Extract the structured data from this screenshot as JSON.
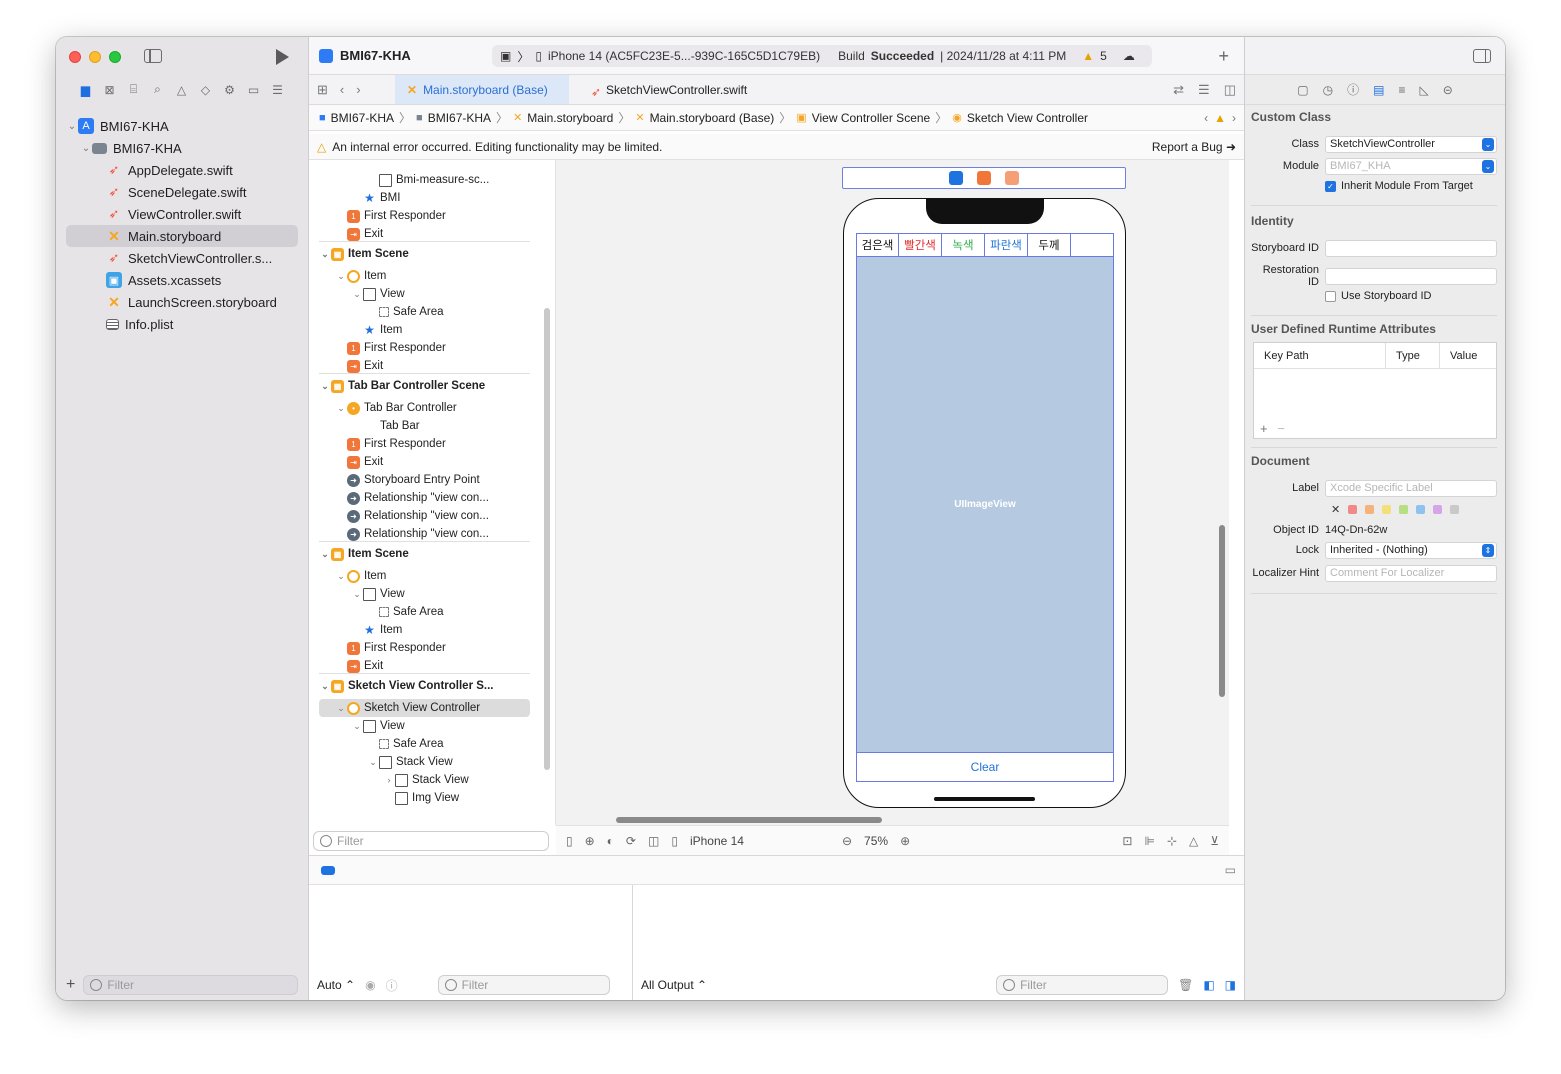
{
  "project": {
    "name": "BMI67-KHA",
    "folder": "BMI67-KHA"
  },
  "navigator": {
    "files": [
      {
        "name": "AppDelegate.swift",
        "type": "swift"
      },
      {
        "name": "SceneDelegate.swift",
        "type": "swift"
      },
      {
        "name": "ViewController.swift",
        "type": "swift"
      },
      {
        "name": "Main.storyboard",
        "type": "storyboard",
        "selected": true
      },
      {
        "name": "SketchViewController.s...",
        "type": "swift"
      },
      {
        "name": "Assets.xcassets",
        "type": "assets"
      },
      {
        "name": "LaunchScreen.storyboard",
        "type": "storyboard"
      },
      {
        "name": "Info.plist",
        "type": "plist"
      }
    ],
    "filter_placeholder": "Filter"
  },
  "toolbar": {
    "device": "iPhone 14 (AC5FC23E-5...-939C-165C5D1C79EB)",
    "build_label": "Build",
    "build_status": "Succeeded",
    "build_time": "| 2024/11/28 at 4:11 PM",
    "warnings": "5"
  },
  "tabs": [
    {
      "label": "Main.storyboard (Base)",
      "active": true
    },
    {
      "label": "SketchViewController.swift",
      "active": false
    }
  ],
  "breadcrumb": [
    "BMI67-KHA",
    "BMI67-KHA",
    "Main.storyboard",
    "Main.storyboard (Base)",
    "View Controller Scene",
    "Sketch View Controller"
  ],
  "error_bar": {
    "message": "An internal error occurred. Editing functionality may be limited.",
    "report": "Report a Bug"
  },
  "outline": {
    "rows": [
      {
        "text": "Bmi-measure-sc...",
        "icon": "img",
        "indent": 4
      },
      {
        "text": "BMI",
        "icon": "star",
        "indent": 3
      },
      {
        "text": "First Responder",
        "icon": "resp",
        "indent": 2
      },
      {
        "text": "Exit",
        "icon": "exit",
        "indent": 2
      },
      {
        "text": "Item Scene",
        "icon": "scene",
        "indent": 1,
        "header": true
      },
      {
        "text": "Item",
        "icon": "item",
        "indent": 2
      },
      {
        "text": "View",
        "icon": "view",
        "indent": 3
      },
      {
        "text": "Safe Area",
        "icon": "safe",
        "indent": 4
      },
      {
        "text": "Item",
        "icon": "star",
        "indent": 3
      },
      {
        "text": "First Responder",
        "icon": "resp",
        "indent": 2
      },
      {
        "text": "Exit",
        "icon": "exit",
        "indent": 2
      },
      {
        "text": "Tab Bar Controller Scene",
        "icon": "scene",
        "indent": 1,
        "header": true
      },
      {
        "text": "Tab Bar Controller",
        "icon": "tabbar",
        "indent": 2
      },
      {
        "text": "Tab Bar",
        "icon": "none",
        "indent": 3
      },
      {
        "text": "First Responder",
        "icon": "resp",
        "indent": 2
      },
      {
        "text": "Exit",
        "icon": "exit",
        "indent": 2
      },
      {
        "text": "Storyboard Entry Point",
        "icon": "entry",
        "indent": 2
      },
      {
        "text": "Relationship \"view con...",
        "icon": "entry",
        "indent": 2
      },
      {
        "text": "Relationship \"view con...",
        "icon": "entry",
        "indent": 2
      },
      {
        "text": "Relationship \"view con...",
        "icon": "entry",
        "indent": 2
      },
      {
        "text": "Item Scene",
        "icon": "scene",
        "indent": 1,
        "header": true
      },
      {
        "text": "Item",
        "icon": "item",
        "indent": 2
      },
      {
        "text": "View",
        "icon": "view",
        "indent": 3
      },
      {
        "text": "Safe Area",
        "icon": "safe",
        "indent": 4
      },
      {
        "text": "Item",
        "icon": "star",
        "indent": 3
      },
      {
        "text": "First Responder",
        "icon": "resp",
        "indent": 2
      },
      {
        "text": "Exit",
        "icon": "exit",
        "indent": 2
      },
      {
        "text": "Sketch View Controller S...",
        "icon": "scene",
        "indent": 1,
        "header": true
      },
      {
        "text": "Sketch View Controller",
        "icon": "item",
        "indent": 2,
        "selected": true
      },
      {
        "text": "View",
        "icon": "view",
        "indent": 3
      },
      {
        "text": "Safe Area",
        "icon": "safe",
        "indent": 4
      },
      {
        "text": "Stack View",
        "icon": "view",
        "indent": 4
      },
      {
        "text": "Stack View",
        "icon": "view",
        "indent": 5
      },
      {
        "text": "Img View",
        "icon": "img",
        "indent": 5
      }
    ],
    "filter_placeholder": "Filter"
  },
  "canvas": {
    "color_buttons": [
      {
        "label": "검은색",
        "color": "#111111"
      },
      {
        "label": "빨간색",
        "color": "#e02a2a"
      },
      {
        "label": "녹색",
        "color": "#2fae4a"
      },
      {
        "label": "파란색",
        "color": "#1f73d6"
      },
      {
        "label": "두께",
        "color": "#111111"
      }
    ],
    "image_view_label": "UIImageView",
    "clear_label": "Clear",
    "device_label": "iPhone 14",
    "zoom": "75%"
  },
  "debug": {
    "auto_label": "Auto ⌃",
    "output_label": "All Output ⌃",
    "filter_placeholder": "Filter"
  },
  "inspector": {
    "custom_class_title": "Custom Class",
    "class_label": "Class",
    "class_value": "SketchViewController",
    "module_label": "Module",
    "module_value": "BMI67_KHA",
    "inherit_label": "Inherit Module From Target",
    "identity_title": "Identity",
    "storyboard_id_label": "Storyboard ID",
    "restoration_id_label": "Restoration ID",
    "use_storyboard_id_label": "Use Storyboard ID",
    "runtime_title": "User Defined Runtime Attributes",
    "kv_headers": [
      "Key Path",
      "Type",
      "Value"
    ],
    "document_title": "Document",
    "label_label": "Label",
    "label_placeholder": "Xcode Specific Label",
    "object_id_label": "Object ID",
    "object_id_value": "14Q-Dn-62w",
    "lock_label": "Lock",
    "lock_value": "Inherited - (Nothing)",
    "localizer_label": "Localizer Hint",
    "localizer_placeholder": "Comment For Localizer",
    "label_colors": [
      "#f08a8a",
      "#f5b37a",
      "#f3e07a",
      "#b6de82",
      "#8ec3ef",
      "#d6a4e8",
      "#c9c9c9"
    ]
  }
}
